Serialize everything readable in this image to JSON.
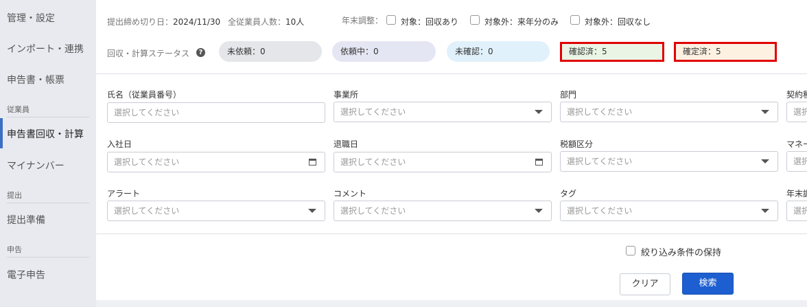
{
  "sidebar": {
    "items": [
      {
        "label": "管理・設定"
      },
      {
        "label": "インポート・連携"
      },
      {
        "label": "申告書・帳票"
      },
      {
        "label": "申告書回収・計算"
      },
      {
        "label": "マイナンバー"
      },
      {
        "label": "提出準備"
      },
      {
        "label": "電子申告"
      }
    ],
    "sections": [
      "従業員",
      "提出",
      "申告"
    ]
  },
  "header": {
    "deadline_label": "提出締め切り日：",
    "deadline_value": "2024/11/30",
    "employee_count_label": "全従業員人数：",
    "employee_count_value": "10人",
    "year_end_label": "年末調整：",
    "options": [
      {
        "label": "対象：回収あり"
      },
      {
        "label": "対象外：来年分のみ"
      },
      {
        "label": "対象外：回収なし"
      }
    ]
  },
  "status": {
    "label": "回収・計算ステータス",
    "help_icon": "?",
    "pills": [
      {
        "label": "未依頼：0",
        "color": "#e4e6ea"
      },
      {
        "label": "依頼中：0",
        "color": "#e5e6f3"
      },
      {
        "label": "未確認：0",
        "color": "#e1f1fb"
      },
      {
        "label": "確認済：5",
        "color": "#eaf5e5"
      },
      {
        "label": "確定済：5",
        "color": "#fdf1e2"
      }
    ]
  },
  "filters": {
    "placeholder": "選択してください",
    "row1": [
      "氏名（従業員番号）",
      "事業所",
      "部門",
      "契約種"
    ],
    "row2": [
      "入社日",
      "退職日",
      "税額区分",
      "マネー"
    ],
    "row3": [
      "アラート",
      "コメント",
      "タグ",
      "年末調"
    ],
    "cut_placeholder": "選択"
  },
  "footer": {
    "keep_conditions": "絞り込み条件の保持",
    "clear": "クリア",
    "search": "検索"
  },
  "colors": {
    "accent": "#1d5fd0",
    "highlight_border": "#e00000",
    "sidebar_bg": "#e8eaef"
  }
}
